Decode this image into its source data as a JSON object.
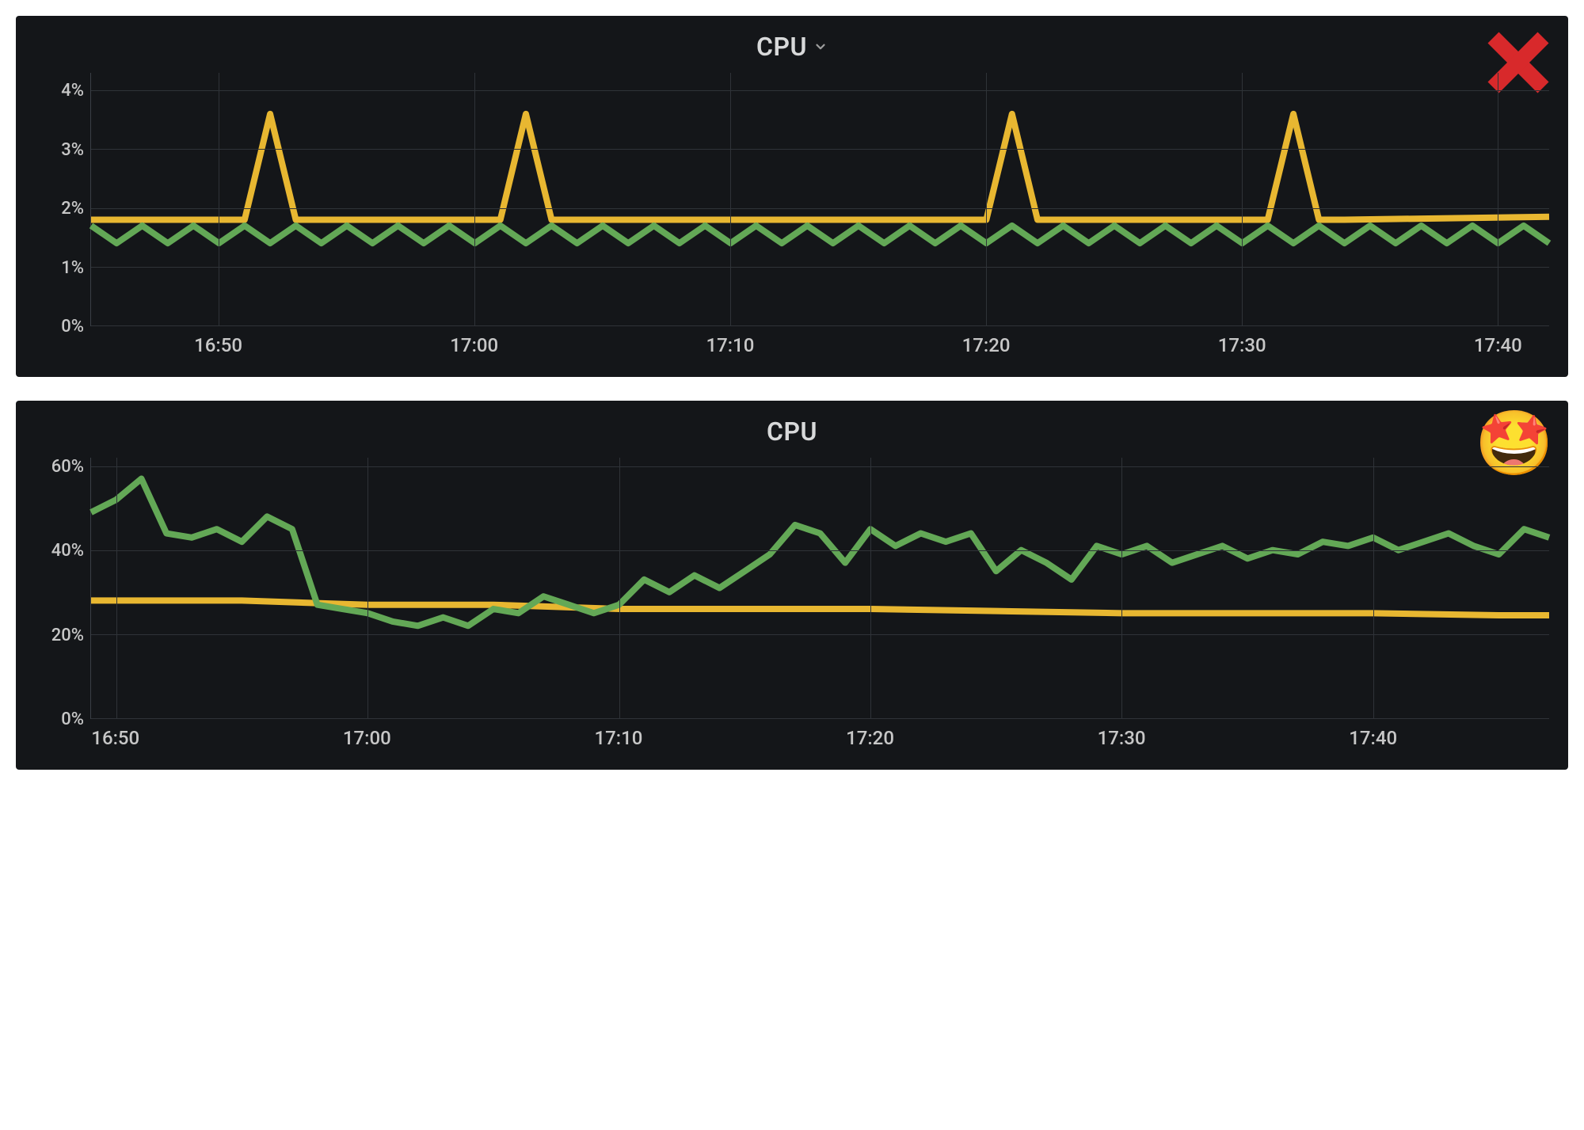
{
  "chart_data": [
    {
      "id": "top",
      "type": "line",
      "title": "CPU",
      "has_dropdown": true,
      "overlay": "cross",
      "ylabel": "",
      "xlabel": "",
      "ylim": [
        0,
        4.3
      ],
      "xlim_minutes": [
        1005,
        1062
      ],
      "y_ticks": [
        0,
        1,
        2,
        3,
        4
      ],
      "y_tick_labels": [
        "0%",
        "1%",
        "2%",
        "3%",
        "4%"
      ],
      "x_tick_minutes": [
        1010,
        1020,
        1030,
        1040,
        1050,
        1060
      ],
      "x_tick_labels": [
        "16:50",
        "17:00",
        "17:10",
        "17:20",
        "17:30",
        "17:40"
      ],
      "colors": {
        "yellow": "#e8b731",
        "green": "#63a856"
      },
      "series": [
        {
          "name": "yellow",
          "color": "#e8b731",
          "x": [
            1005,
            1010,
            1011,
            1012,
            1013,
            1014,
            1020,
            1021,
            1022,
            1023,
            1024,
            1030,
            1039,
            1040,
            1041,
            1042,
            1043,
            1050,
            1051,
            1052,
            1053,
            1054,
            1062
          ],
          "y": [
            1.8,
            1.8,
            1.8,
            3.6,
            1.8,
            1.8,
            1.8,
            1.8,
            3.6,
            1.8,
            1.8,
            1.8,
            1.8,
            1.8,
            3.6,
            1.8,
            1.8,
            1.8,
            1.8,
            3.6,
            1.8,
            1.8,
            1.85
          ]
        },
        {
          "name": "green",
          "color": "#63a856",
          "x": [
            1005,
            1006,
            1007,
            1008,
            1009,
            1010,
            1011,
            1012,
            1013,
            1014,
            1015,
            1016,
            1017,
            1018,
            1019,
            1020,
            1021,
            1022,
            1023,
            1024,
            1025,
            1026,
            1027,
            1028,
            1029,
            1030,
            1031,
            1032,
            1033,
            1034,
            1035,
            1036,
            1037,
            1038,
            1039,
            1040,
            1041,
            1042,
            1043,
            1044,
            1045,
            1046,
            1047,
            1048,
            1049,
            1050,
            1051,
            1052,
            1053,
            1054,
            1055,
            1056,
            1057,
            1058,
            1059,
            1060,
            1061,
            1062
          ],
          "y": [
            1.7,
            1.4,
            1.7,
            1.4,
            1.7,
            1.4,
            1.7,
            1.4,
            1.7,
            1.4,
            1.7,
            1.4,
            1.7,
            1.4,
            1.7,
            1.4,
            1.7,
            1.4,
            1.7,
            1.4,
            1.7,
            1.4,
            1.7,
            1.4,
            1.7,
            1.4,
            1.7,
            1.4,
            1.7,
            1.4,
            1.7,
            1.4,
            1.7,
            1.4,
            1.7,
            1.4,
            1.7,
            1.4,
            1.7,
            1.4,
            1.7,
            1.4,
            1.7,
            1.4,
            1.7,
            1.4,
            1.7,
            1.4,
            1.7,
            1.4,
            1.7,
            1.4,
            1.7,
            1.4,
            1.7,
            1.4,
            1.7,
            1.4
          ]
        }
      ]
    },
    {
      "id": "bottom",
      "type": "line",
      "title": "CPU",
      "has_dropdown": false,
      "overlay": "star-struck",
      "ylabel": "",
      "xlabel": "",
      "ylim": [
        0,
        62
      ],
      "xlim_minutes": [
        1009,
        1067
      ],
      "y_ticks": [
        0,
        20,
        40,
        60
      ],
      "y_tick_labels": [
        "0%",
        "20%",
        "40%",
        "60%"
      ],
      "x_tick_minutes": [
        1010,
        1020,
        1030,
        1040,
        1050,
        1060
      ],
      "x_tick_labels": [
        "16:50",
        "17:00",
        "17:10",
        "17:20",
        "17:30",
        "17:40"
      ],
      "colors": {
        "yellow": "#e8b731",
        "green": "#63a856"
      },
      "series": [
        {
          "name": "yellow",
          "color": "#e8b731",
          "x": [
            1009,
            1010,
            1012,
            1015,
            1020,
            1025,
            1030,
            1035,
            1040,
            1045,
            1050,
            1055,
            1060,
            1065,
            1067
          ],
          "y": [
            28,
            28,
            28,
            28,
            27,
            27,
            26,
            26,
            26,
            25.5,
            25,
            25,
            25,
            24.5,
            24.5
          ]
        },
        {
          "name": "green",
          "color": "#63a856",
          "x": [
            1009,
            1010,
            1011,
            1012,
            1013,
            1014,
            1015,
            1016,
            1017,
            1018,
            1019,
            1020,
            1021,
            1022,
            1023,
            1024,
            1025,
            1026,
            1027,
            1028,
            1029,
            1030,
            1031,
            1032,
            1033,
            1034,
            1035,
            1036,
            1037,
            1038,
            1039,
            1040,
            1041,
            1042,
            1043,
            1044,
            1045,
            1046,
            1047,
            1048,
            1049,
            1050,
            1051,
            1052,
            1053,
            1054,
            1055,
            1056,
            1057,
            1058,
            1059,
            1060,
            1061,
            1062,
            1063,
            1064,
            1065,
            1066,
            1067
          ],
          "y": [
            49,
            52,
            57,
            44,
            43,
            45,
            42,
            48,
            45,
            27,
            26,
            25,
            23,
            22,
            24,
            22,
            26,
            25,
            29,
            27,
            25,
            27,
            33,
            30,
            34,
            31,
            35,
            39,
            46,
            44,
            37,
            45,
            41,
            44,
            42,
            44,
            35,
            40,
            37,
            33,
            41,
            39,
            41,
            37,
            39,
            41,
            38,
            40,
            39,
            42,
            41,
            43,
            40,
            42,
            44,
            41,
            39,
            45,
            43
          ]
        }
      ]
    }
  ]
}
